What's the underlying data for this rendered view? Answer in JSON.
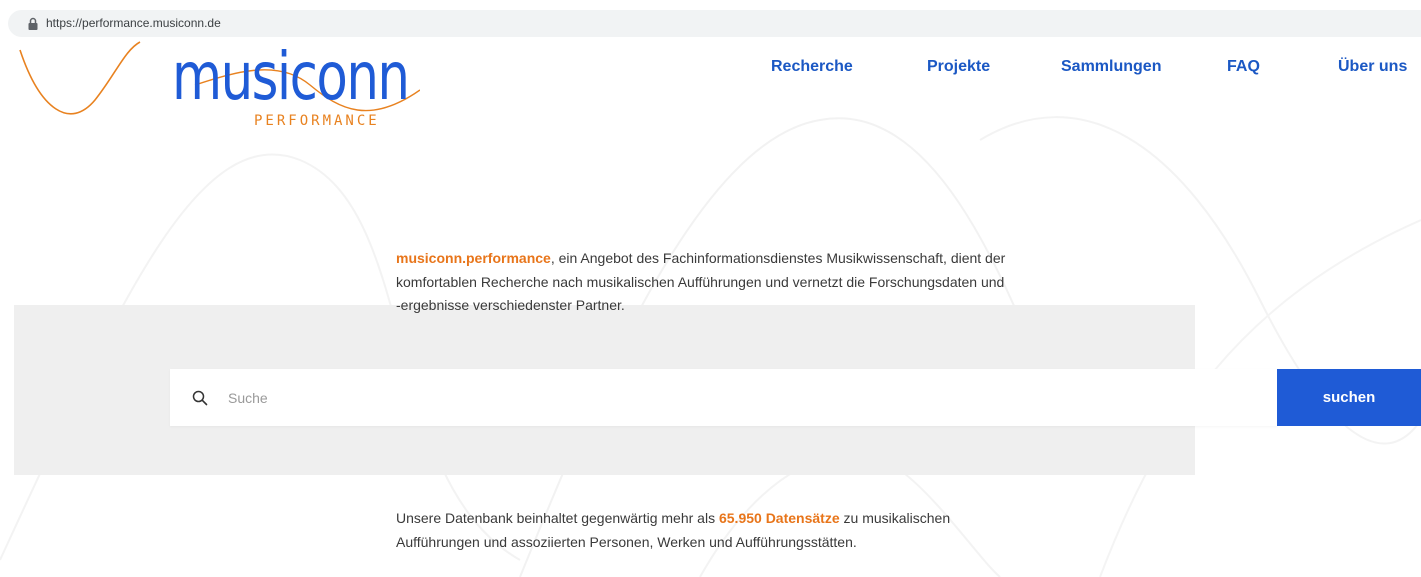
{
  "browser": {
    "url": "https://performance.musiconn.de",
    "icon": "lock-icon"
  },
  "logo": {
    "word": "musiconn",
    "subtitle": "PERFORMANCE",
    "colors": {
      "word": "#1f5bd6",
      "subtitle": "#e88220",
      "wave": "#e88220"
    }
  },
  "nav": {
    "items": [
      {
        "label": "Recherche"
      },
      {
        "label": "Projekte"
      },
      {
        "label": "Sammlungen"
      },
      {
        "label": "FAQ"
      },
      {
        "label": "Über uns"
      }
    ]
  },
  "intro": {
    "brand": "musiconn.performance",
    "text": ", ein Angebot des Fachinformationsdienstes Musikwissenschaft, dient der komfortablen Recherche nach musikalischen Aufführungen und vernetzt die Forschungsdaten und -ergebnisse verschiedenster Partner."
  },
  "search": {
    "placeholder": "Suche",
    "value": "",
    "button_label": "suchen",
    "icon": "search-icon"
  },
  "database": {
    "text_before": "Unsere Datenbank beinhaltet gegenwärtig mehr als ",
    "count": "65.950 Datensätze",
    "text_after": " zu musikalischen Aufführungen und assoziierten Personen, Werken und Aufführungsstätten."
  },
  "colors": {
    "accent_blue": "#1f5bd6",
    "accent_orange": "#e8751a",
    "band_grey": "#efefef"
  }
}
